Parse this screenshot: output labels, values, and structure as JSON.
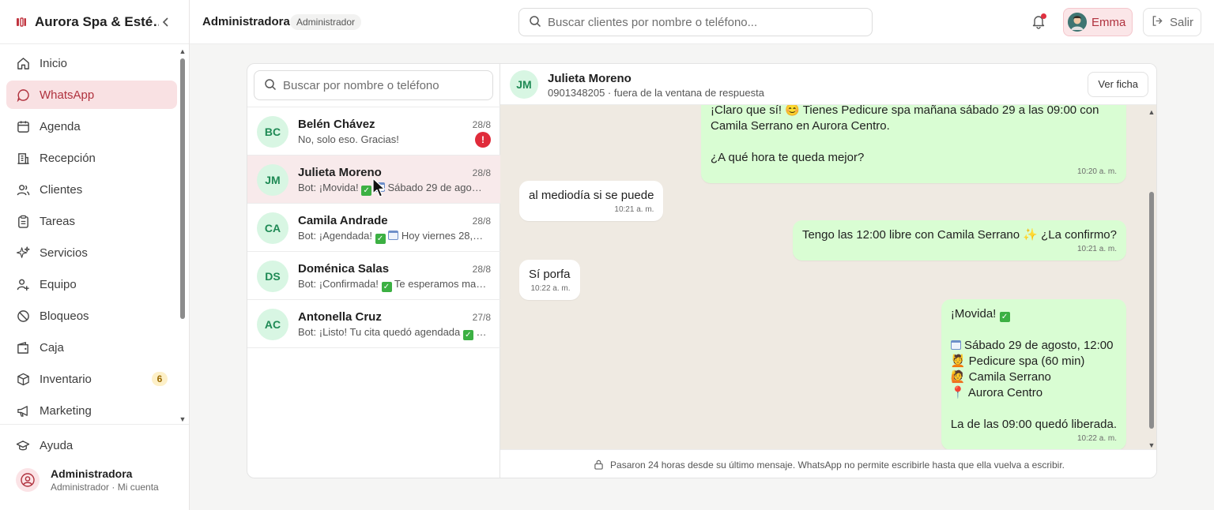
{
  "brand": {
    "name": "Aurora Spa & Esté…"
  },
  "nav": {
    "items": [
      {
        "label": "Inicio",
        "icon": "home-icon"
      },
      {
        "label": "WhatsApp",
        "icon": "chat-bubble-icon",
        "active": true
      },
      {
        "label": "Agenda",
        "icon": "calendar-icon"
      },
      {
        "label": "Recepción",
        "icon": "building-icon"
      },
      {
        "label": "Clientes",
        "icon": "users-icon"
      },
      {
        "label": "Tareas",
        "icon": "clipboard-icon"
      },
      {
        "label": "Servicios",
        "icon": "sparkles-icon"
      },
      {
        "label": "Equipo",
        "icon": "team-icon"
      },
      {
        "label": "Bloqueos",
        "icon": "ban-icon"
      },
      {
        "label": "Caja",
        "icon": "wallet-icon"
      },
      {
        "label": "Inventario",
        "icon": "box-icon",
        "badge": "6"
      },
      {
        "label": "Marketing",
        "icon": "megaphone-icon"
      }
    ],
    "help": "Ayuda"
  },
  "user": {
    "name": "Administradora",
    "sub": "Administrador · Mi cuenta"
  },
  "topbar": {
    "title": "Administradora",
    "role": "Administrador",
    "search_placeholder": "Buscar clientes por nombre o teléfono...",
    "emma": "Emma",
    "logout": "Salir"
  },
  "list": {
    "search_placeholder": "Buscar por nombre o teléfono",
    "conversations": [
      {
        "initials": "BC",
        "name": "Belén Chávez",
        "date": "28/8",
        "preview": "No, solo eso. Gracias!",
        "alert": "!"
      },
      {
        "initials": "JM",
        "name": "Julieta Moreno",
        "date": "28/8",
        "preview_a": "Bot: ¡Movida! ",
        "preview_b": " Sábado 29 de ago…",
        "active": true
      },
      {
        "initials": "CA",
        "name": "Camila Andrade",
        "date": "28/8",
        "preview_a": "Bot: ¡Agendada! ",
        "preview_b": " Hoy viernes 28,…"
      },
      {
        "initials": "DS",
        "name": "Doménica Salas",
        "date": "28/8",
        "preview_a": "Bot: ¡Confirmada! ",
        "preview_b": " Te esperamos ma…"
      },
      {
        "initials": "AC",
        "name": "Antonella Cruz",
        "date": "27/8",
        "preview_a": "Bot: ¡Listo! Tu cita quedó agendada ",
        "preview_b": " …"
      }
    ]
  },
  "chat": {
    "initials": "JM",
    "name": "Julieta Moreno",
    "sub": "0901348205 · fuera de la ventana de respuesta",
    "ver_ficha": "Ver ficha",
    "messages": {
      "m1": {
        "l1": "¡Claro que sí! 😊 Tienes Pedicure spa mañana sábado 29 a las 09:00 con",
        "l2": "Camila Serrano en Aurora Centro.",
        "l3": "¿A qué hora te queda mejor?",
        "time": "10:20 a. m."
      },
      "m2": {
        "text": "al mediodía si se puede",
        "time": "10:21 a. m."
      },
      "m3": {
        "text": "Tengo las 12:00 libre con Camila Serrano ✨ ¿La confirmo?",
        "time": "10:21 a. m."
      },
      "m4": {
        "text": "Sí porfa",
        "time": "10:22 a. m."
      },
      "m5": {
        "l1": "¡Movida! ",
        "l2": " Sábado 29 de agosto, 12:00",
        "l3": "💆 Pedicure spa (60 min)",
        "l4": "🙋 Camila Serrano",
        "l5": "📍 Aurora Centro",
        "l6": "La de las 09:00 quedó liberada.",
        "time": "10:22 a. m."
      }
    },
    "footer": "Pasaron 24 horas desde su último mensaje. WhatsApp no permite escribirle hasta que ella vuelva a escribir."
  },
  "colors": {
    "accent": "#b0323e",
    "active_bg": "#f9e1e3",
    "out_bubble": "#d9fdd3",
    "chat_bg": "#efeae2",
    "avatar_bg": "#d8f6e3"
  }
}
